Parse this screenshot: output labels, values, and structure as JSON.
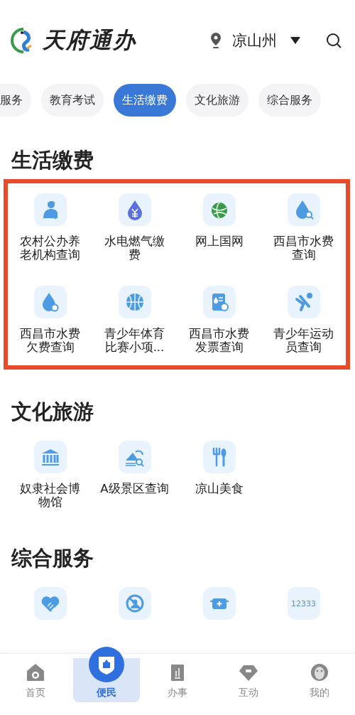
{
  "header": {
    "app_name": "天府通办",
    "location": "凉山州"
  },
  "categories": [
    {
      "label": "服务",
      "selected": false
    },
    {
      "label": "教育考试",
      "selected": false
    },
    {
      "label": "生活缴费",
      "selected": true
    },
    {
      "label": "文化旅游",
      "selected": false
    },
    {
      "label": "综合服务",
      "selected": false
    }
  ],
  "sections": [
    {
      "title": "生活缴费",
      "highlighted": true,
      "items": [
        {
          "label": "农村公办养老机构查询",
          "kind": "elder"
        },
        {
          "label": "水电燃气缴费",
          "kind": "yen-drop"
        },
        {
          "label": "网上国网",
          "kind": "grid-globe"
        },
        {
          "label": "西昌市水费查询",
          "kind": "drop-search"
        },
        {
          "label": "西昌市水费欠费查询",
          "kind": "drop-coin"
        },
        {
          "label": "青少年体育比赛小项...",
          "kind": "ball"
        },
        {
          "label": "西昌市水费发票查询",
          "kind": "receipt"
        },
        {
          "label": "青少年运动员查询",
          "kind": "runner"
        }
      ]
    },
    {
      "title": "文化旅游",
      "highlighted": false,
      "items": [
        {
          "label": "奴隶社会博物馆",
          "kind": "museum"
        },
        {
          "label": "A级景区查询",
          "kind": "scenery"
        },
        {
          "label": "凉山美食",
          "kind": "cutlery"
        }
      ]
    },
    {
      "title": "综合服务",
      "highlighted": false,
      "items": [
        {
          "kind": "heart"
        },
        {
          "kind": "ban"
        },
        {
          "kind": "medkit"
        },
        {
          "kind": "number",
          "badge": "12333"
        }
      ]
    }
  ],
  "tabs": [
    {
      "label": "首页",
      "kind": "home",
      "selected": false
    },
    {
      "label": "便民",
      "kind": "shield",
      "selected": true
    },
    {
      "label": "办事",
      "kind": "clipboard",
      "selected": false
    },
    {
      "label": "互动",
      "kind": "gem",
      "selected": false
    },
    {
      "label": "我的",
      "kind": "mask",
      "selected": false
    }
  ]
}
